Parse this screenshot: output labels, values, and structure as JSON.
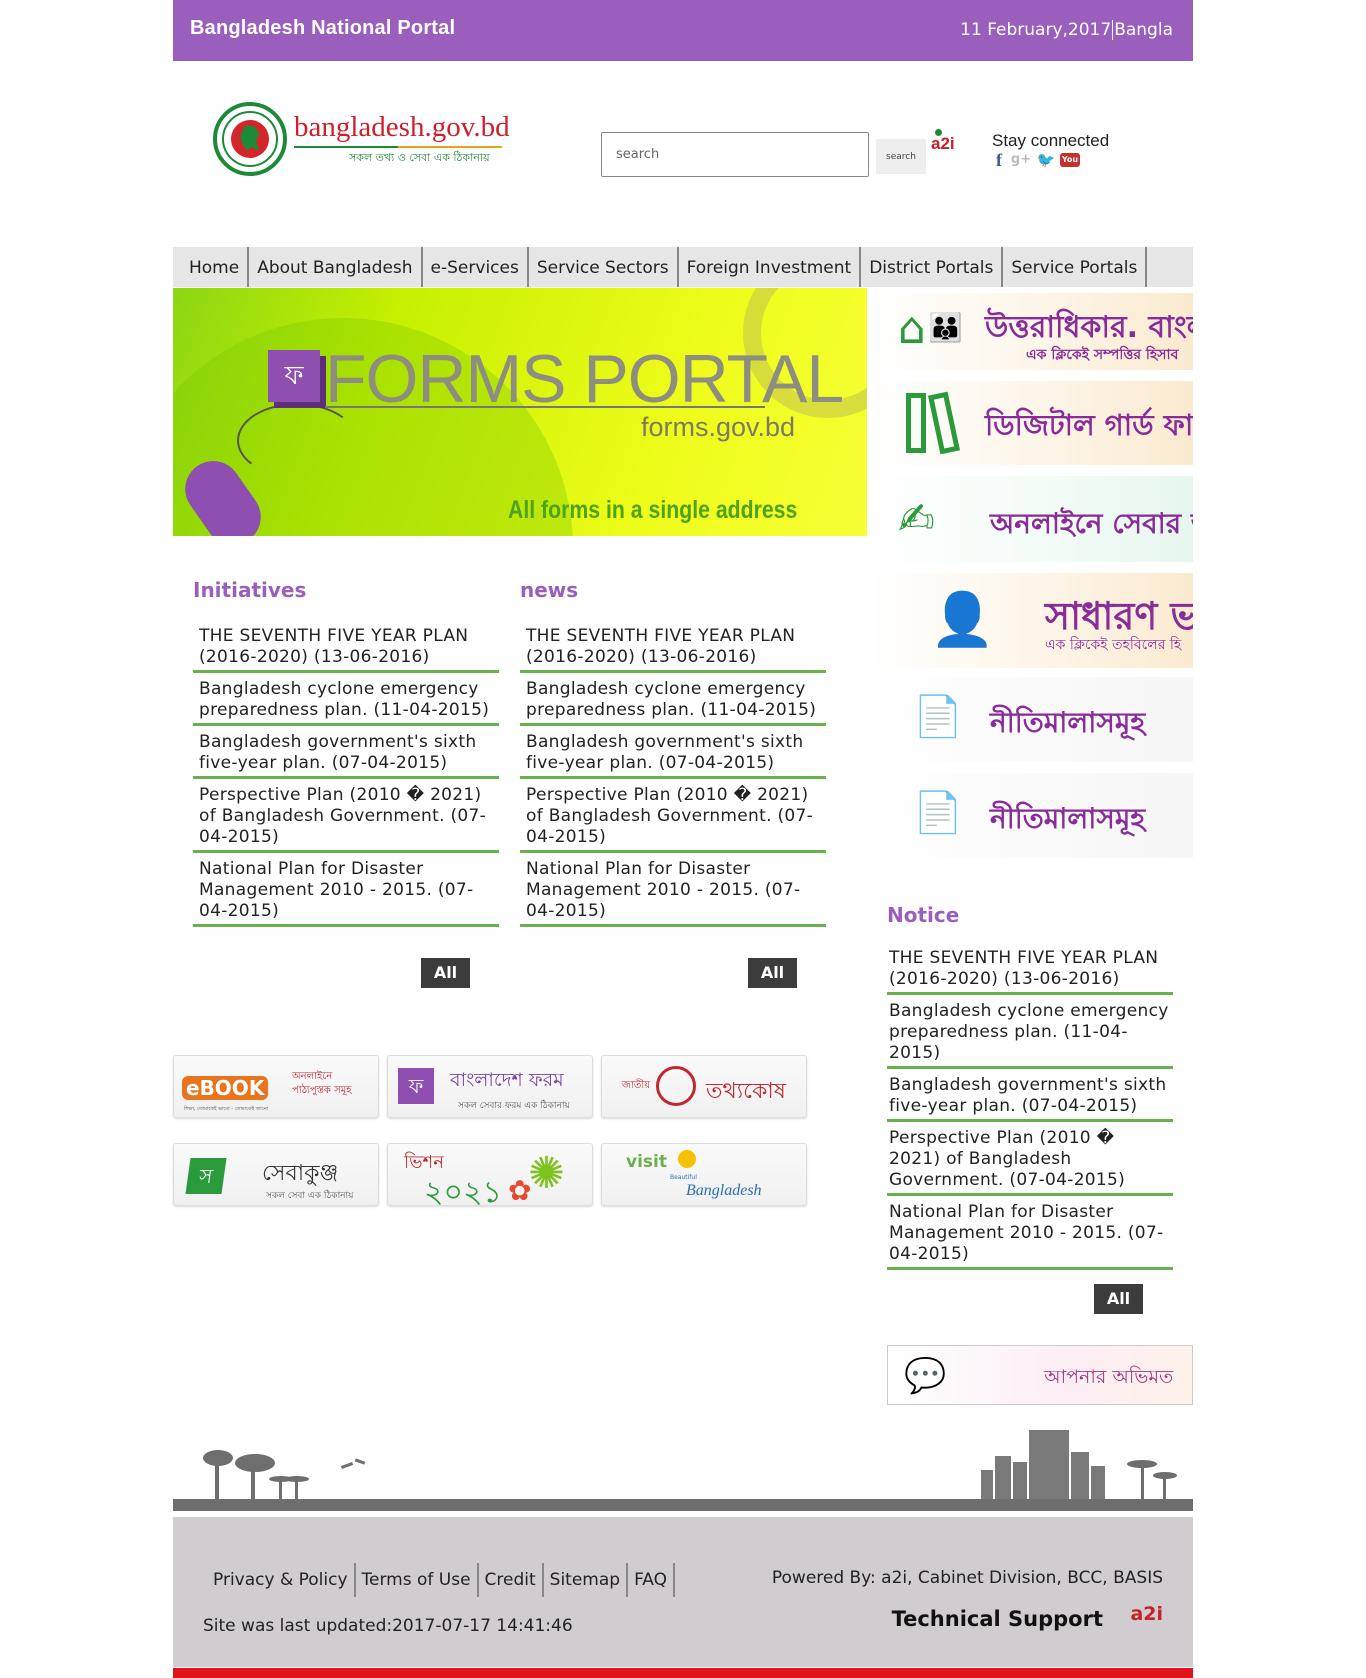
{
  "topbar": {
    "site_name": "Bangladesh National Portal",
    "date": "11 February,2017",
    "language": "Bangla"
  },
  "header": {
    "logo_text": "bangladesh.gov.bd",
    "logo_tagline": "সকল তথ্য ও সেবা এক ঠিকানায়",
    "search_placeholder": "search",
    "search_button": "search",
    "a2i_logo": "a2i",
    "stay_connected": "Stay connected",
    "social": [
      "facebook-icon",
      "google-plus-icon",
      "twitter-icon",
      "youtube-icon"
    ]
  },
  "nav": {
    "items": [
      {
        "label": "Home"
      },
      {
        "label": "About Bangladesh"
      },
      {
        "label": "e-Services"
      },
      {
        "label": "Service Sectors"
      },
      {
        "label": "Foreign Investment"
      },
      {
        "label": "District Portals"
      },
      {
        "label": "Service Portals"
      }
    ]
  },
  "banner": {
    "title": "FORMS PORTAL",
    "url": "forms.gov.bd",
    "tagline": "All forms in a single address",
    "icon_glyph": "ফ"
  },
  "right_banners": [
    {
      "text": "উত্তরাধিকার. বাংলা",
      "sub": "এক ক্লিকেই সম্পত্তির হিসাব",
      "icon": "house-family-icon"
    },
    {
      "text": "ডিজিটাল গার্ড ফাইল",
      "sub": "",
      "icon": "binders-icon"
    },
    {
      "text": "অনলাইনে সেবার আ",
      "sub": "",
      "icon": "online-application-icon"
    },
    {
      "text": "সাধারণ ভ",
      "sub": "এক ক্লিকেই তহবিলের হি",
      "icon": "fund-person-icon"
    },
    {
      "text": "নীতিমালাসমূহ",
      "sub": "",
      "icon": "document-hand-icon"
    },
    {
      "text": "নীতিমালাসমূহ",
      "sub": "",
      "icon": "document-hand-icon"
    }
  ],
  "initiatives": {
    "title": "Initiatives",
    "items": [
      "THE SEVENTH FIVE YEAR PLAN (2016-2020) (13-06-2016)",
      "Bangladesh cyclone emergency preparedness plan. (11-04-2015)",
      "Bangladesh government's sixth five-year plan. (07-04-2015)",
      "Perspective Plan (2010 � 2021) of Bangladesh Government. (07-04-2015)",
      "National Plan for Disaster Management 2010 - 2015. (07-04-2015)"
    ],
    "all_label": "All"
  },
  "news": {
    "title": "news",
    "items": [
      "THE SEVENTH FIVE YEAR PLAN (2016-2020) (13-06-2016)",
      "Bangladesh cyclone emergency preparedness plan. (11-04-2015)",
      "Bangladesh government's sixth five-year plan. (07-04-2015)",
      "Perspective Plan (2010 � 2021) of Bangladesh Government. (07-04-2015)",
      "National Plan for Disaster Management 2010 - 2015. (07-04-2015)"
    ],
    "all_label": "All"
  },
  "notice": {
    "title": "Notice",
    "items": [
      "THE SEVENTH FIVE YEAR PLAN (2016-2020) (13-06-2016)",
      "Bangladesh cyclone emergency preparedness plan. (11-04-2015)",
      "Bangladesh government's sixth five-year plan. (07-04-2015)",
      "Perspective Plan (2010 � 2021) of Bangladesh Government. (07-04-2015)",
      "National Plan for Disaster Management 2010 - 2015. (07-04-2015)"
    ],
    "all_label": "All"
  },
  "tiles": [
    {
      "name": "ebook",
      "badge": "eBOOK",
      "text": "অনলাইনে পাঠ্যপুস্তক সমূহ",
      "sub": "শিক্ষা, তোমাকেই ভাবো - তোমাকেই জানো"
    },
    {
      "name": "bangladesh-form",
      "badge": "ফ",
      "text": "বাংলাদেশ ফরম",
      "sub": "সকল সেবার ফরম এক ঠিকানায়"
    },
    {
      "name": "tothyokosh",
      "badge": "জাতীয়",
      "text": "তথ্যকোষ",
      "sub": ""
    },
    {
      "name": "sebakunjo",
      "badge": "স",
      "text": "সেবাকুঞ্জ",
      "sub": "সকল সেবা এক ঠিকানায়"
    },
    {
      "name": "vision-2021",
      "badge": "ভিশন",
      "text": "২০২১",
      "sub": ""
    },
    {
      "name": "visit-bangladesh",
      "badge": "visit",
      "text": "Bangladesh",
      "sub": "Beautiful"
    }
  ],
  "feedback": {
    "text": "আপনার অভিমত"
  },
  "footer": {
    "links": [
      "Privacy & Policy",
      "Terms of Use",
      "Credit",
      "Sitemap",
      "FAQ"
    ],
    "updated": "Site was last updated:2017-07-17 14:41:46",
    "powered_by": "Powered By: a2i, Cabinet Division, BCC, BASIS",
    "tech_support": "Technical Support",
    "tech_logo": "a2i"
  },
  "colors": {
    "brand_purple": "#9a5ebd",
    "divider_green": "#6ab04c",
    "footer_bg": "#d1cccf",
    "bottom_red": "#e0141c"
  }
}
